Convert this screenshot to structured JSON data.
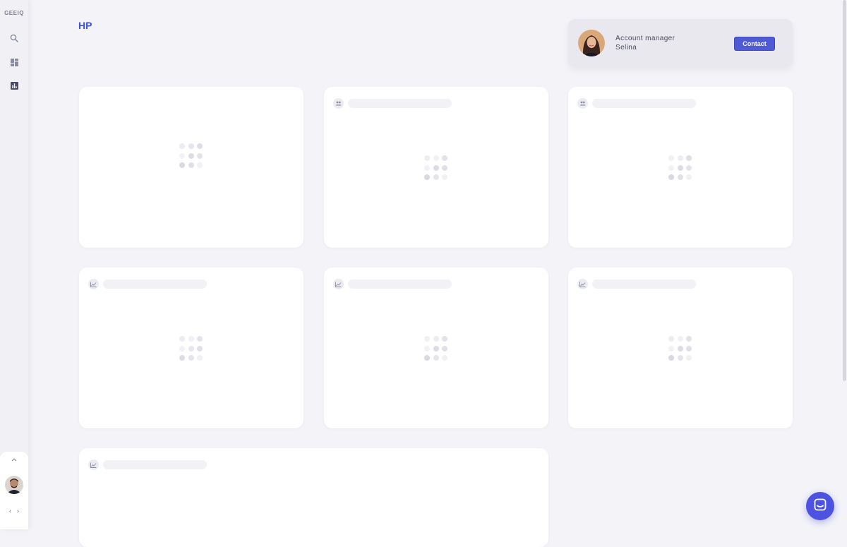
{
  "app": {
    "logo": "GEEIQ"
  },
  "sidebar": {
    "items": [
      {
        "icon": "search-icon"
      },
      {
        "icon": "dashboard-icon"
      },
      {
        "icon": "bar-chart-icon"
      }
    ],
    "bottom": {
      "collapse_icon": "chevron-up-icon",
      "code_label": "‹ ›"
    }
  },
  "page": {
    "title": "HP"
  },
  "account_manager": {
    "role": "Account manager",
    "name": "Selina",
    "contact_label": "Contact"
  },
  "cards": [
    {
      "icon": "none",
      "loading": true
    },
    {
      "icon": "people-icon",
      "loading": true
    },
    {
      "icon": "people-icon",
      "loading": true
    },
    {
      "icon": "line-chart-icon",
      "loading": true
    },
    {
      "icon": "line-chart-icon",
      "loading": true
    },
    {
      "icon": "line-chart-icon",
      "loading": true
    },
    {
      "icon": "line-chart-icon",
      "loading": true
    }
  ],
  "chat": {
    "icon": "chat-icon"
  },
  "colors": {
    "accent": "#3f51d6",
    "button": "#4f5bd5",
    "chat": "#4b53e0",
    "background": "#f3f3f8"
  }
}
